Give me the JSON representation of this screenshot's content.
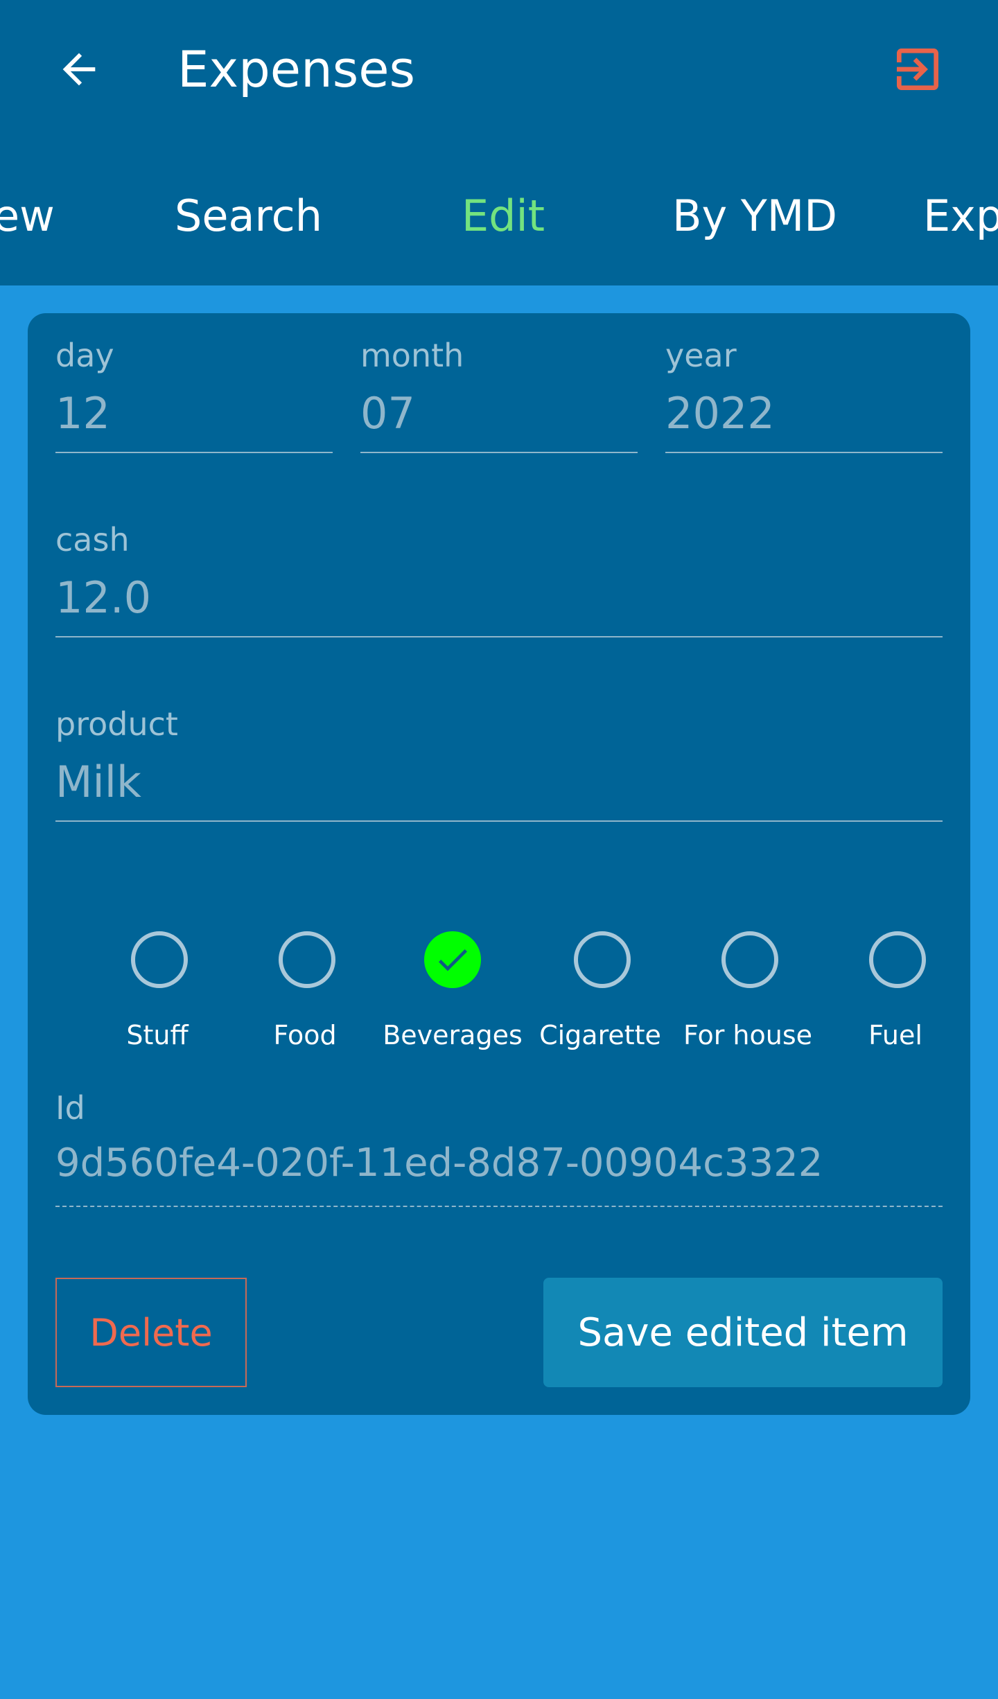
{
  "header": {
    "title": "Expenses",
    "back_icon": "arrow-left-icon",
    "logout_icon": "exit-icon",
    "accent": "#e8634a"
  },
  "tabs": [
    {
      "label": "ew"
    },
    {
      "label": "Search"
    },
    {
      "label": "Edit",
      "active": true
    },
    {
      "label": "By YMD"
    },
    {
      "label": "Exp"
    }
  ],
  "form": {
    "day": {
      "label": "day",
      "value": "12"
    },
    "month": {
      "label": "month",
      "value": "07"
    },
    "year": {
      "label": "year",
      "value": "2022"
    },
    "cash": {
      "label": "cash",
      "value": "12.0"
    },
    "product": {
      "label": "product",
      "value": "Milk"
    },
    "categories": [
      {
        "label": "Stuff",
        "checked": false
      },
      {
        "label": "Food",
        "checked": false
      },
      {
        "label": "Beverages",
        "checked": true
      },
      {
        "label": "Cigarette",
        "checked": false
      },
      {
        "label": "For house",
        "checked": false
      },
      {
        "label": "Fuel",
        "checked": false
      }
    ],
    "id": {
      "label": "Id",
      "value": "9d560fe4-020f-11ed-8d87-00904c3322"
    }
  },
  "actions": {
    "delete_label": "Delete",
    "save_label": "Save edited item"
  },
  "colors": {
    "background": "#1e96df",
    "bar": "#006497",
    "active_tab": "#73e37f",
    "checked": "#00ff00",
    "save_button": "#1288b5",
    "delete_text": "#f06a4f"
  }
}
